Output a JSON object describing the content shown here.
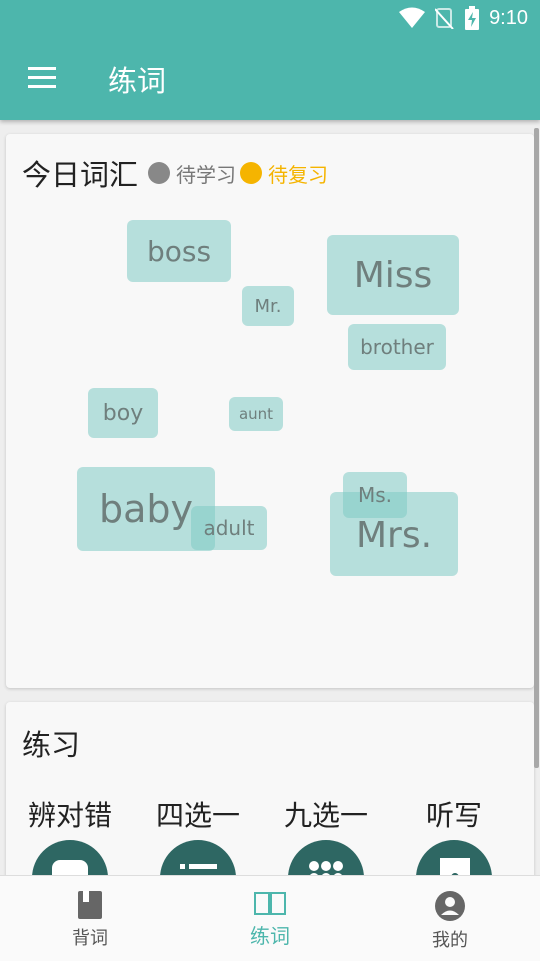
{
  "status_bar": {
    "time": "9:10"
  },
  "app_bar": {
    "title": "练词",
    "menu_icon": "menu-icon"
  },
  "vocab_card": {
    "title": "今日词汇",
    "legend": [
      {
        "label": "待学习",
        "color": "#888888"
      },
      {
        "label": "待复习",
        "color": "#f5b400"
      }
    ],
    "words": [
      "boss",
      "Miss",
      "Mr.",
      "brother",
      "boy",
      "aunt",
      "baby",
      "adult",
      "Ms.",
      "Mrs."
    ]
  },
  "practice_card": {
    "title": "练习",
    "items": [
      {
        "label": "辨对错",
        "icon": "chat-bubble-icon"
      },
      {
        "label": "四选一",
        "icon": "list-icon"
      },
      {
        "label": "九选一",
        "icon": "grid-icon"
      },
      {
        "label": "听写",
        "icon": "dictation-icon"
      }
    ]
  },
  "bottom_nav": {
    "items": [
      {
        "label": "背词",
        "icon": "book-icon",
        "active": false
      },
      {
        "label": "练词",
        "icon": "open-book-icon",
        "active": true
      },
      {
        "label": "我的",
        "icon": "account-icon",
        "active": false
      }
    ],
    "active_color": "#4db6ac"
  }
}
